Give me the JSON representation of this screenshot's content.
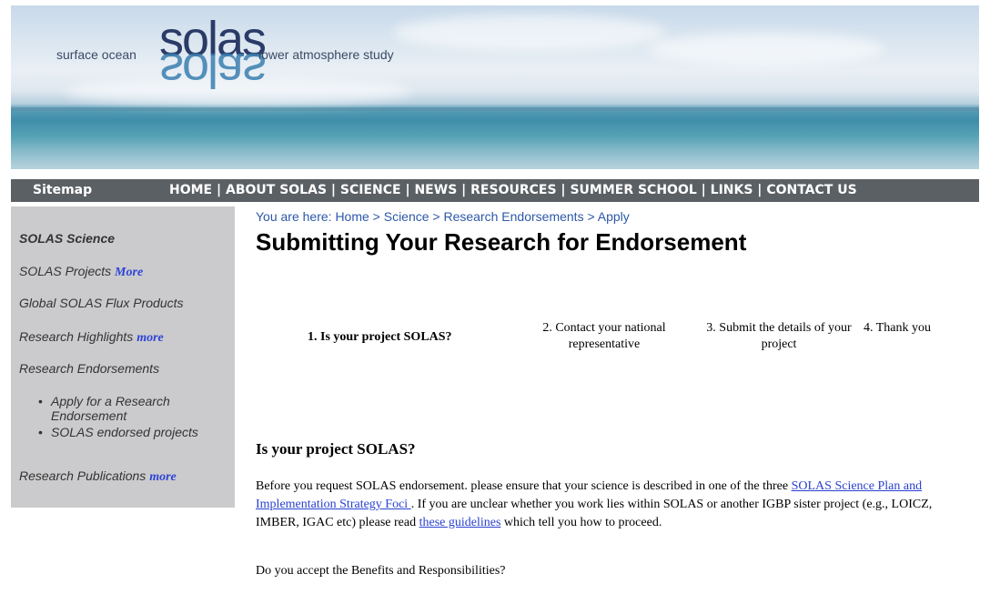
{
  "header": {
    "logo_left": "surface ocean",
    "logo_word": "solas",
    "logo_right": "lower atmosphere study"
  },
  "nav": {
    "sitemap": "Sitemap",
    "links": [
      "HOME",
      "ABOUT SOLAS",
      "SCIENCE",
      "NEWS",
      "RESOURCES",
      "SUMMER SCHOOL",
      "LINKS",
      "CONTACT US"
    ],
    "separator": " | "
  },
  "sidebar": {
    "title": "SOLAS Science",
    "items": [
      {
        "label": "SOLAS Projects",
        "more": "More"
      },
      {
        "label": "Global SOLAS Flux Products"
      },
      {
        "label": "Research Highlights",
        "more": "more"
      },
      {
        "label": "Research Endorsements"
      },
      {
        "label": "Research Publications",
        "more": "more"
      }
    ],
    "sub_items": [
      "Apply for a Research Endorsement",
      "SOLAS endorsed projects"
    ]
  },
  "main": {
    "breadcrumb": "You are here: Home > Science > Research Endorsements > Apply",
    "title": "Submitting Your Research for Endorsement",
    "steps": [
      "1. Is your project SOLAS?",
      "2. Contact your national representative",
      "3. Submit the details of your project",
      "4. Thank you"
    ],
    "section_heading": "Is your project SOLAS?",
    "intro": {
      "part1": "Before you request SOLAS endorsement. please ensure that your science is described in one of the three ",
      "link1": "SOLAS Science Plan and Implementation Strategy Foci ",
      "part2": ". If you are unclear whether you work lies within SOLAS or another IGBP sister project (e.g., LOICZ, IMBER, IGAC etc) please read ",
      "link2": "these guidelines",
      "part3": " which tell you how to proceed."
    },
    "question": "Do you accept the Benefits and Responsibilities?"
  },
  "colors": {
    "nav_bg": "#5b6064",
    "sidebar_bg": "#cbcbcd",
    "link": "#2a41d0",
    "breadcrumb": "#2d58a8"
  }
}
